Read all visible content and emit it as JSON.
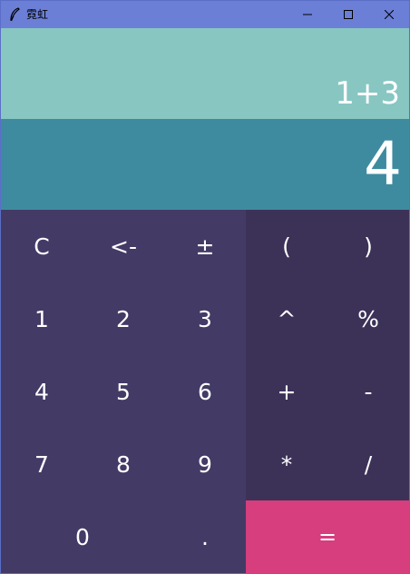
{
  "window": {
    "title": "霓虹",
    "icon": "feather-icon",
    "minimize": "minimize-icon",
    "maximize": "maximize-icon",
    "close": "close-icon"
  },
  "display": {
    "expression": "1+3",
    "result": "4"
  },
  "keys": {
    "clear": "C",
    "backspace": "<-",
    "negate": "±",
    "lparen": "(",
    "rparen": ")",
    "k1": "1",
    "k2": "2",
    "k3": "3",
    "power": "^",
    "percent": "%",
    "k4": "4",
    "k5": "5",
    "k6": "6",
    "plus": "+",
    "minus": "-",
    "k7": "7",
    "k8": "8",
    "k9": "9",
    "multiply": "*",
    "divide": "/",
    "k0": "0",
    "dot": ".",
    "equals": "="
  },
  "colors": {
    "titlebar": "#6b7fd7",
    "expression_bg": "#88c6c2",
    "result_bg": "#3e8ba0",
    "keypad_left": "#433a66",
    "keypad_right": "#3c3258",
    "equals_bg": "#d63e7d"
  }
}
